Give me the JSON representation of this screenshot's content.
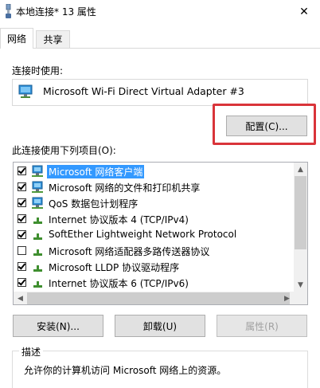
{
  "window": {
    "title": "本地连接* 13 属性",
    "close_glyph": "✕"
  },
  "tabs": [
    {
      "label": "网络",
      "active": true
    },
    {
      "label": "共享",
      "active": false
    }
  ],
  "connect_using": {
    "label": "连接时使用:",
    "adapter_name": "Microsoft Wi-Fi Direct Virtual Adapter #3",
    "adapter_icon": "network-adapter-icon",
    "configure_label": "配置(C)..."
  },
  "items_section": {
    "label": "此连接使用下列项目(O):",
    "items": [
      {
        "label": "Microsoft 网络客户端",
        "checked": true,
        "selected": true,
        "icon": "client-icon"
      },
      {
        "label": "Microsoft 网络的文件和打印机共享",
        "checked": true,
        "selected": false,
        "icon": "client-icon"
      },
      {
        "label": "QoS 数据包计划程序",
        "checked": true,
        "selected": false,
        "icon": "client-icon"
      },
      {
        "label": "Internet 协议版本 4 (TCP/IPv4)",
        "checked": true,
        "selected": false,
        "icon": "protocol-icon"
      },
      {
        "label": "SoftEther Lightweight Network Protocol",
        "checked": true,
        "selected": false,
        "icon": "protocol-icon"
      },
      {
        "label": "Microsoft 网络适配器多路传送器协议",
        "checked": false,
        "selected": false,
        "icon": "protocol-icon"
      },
      {
        "label": "Microsoft LLDP 协议驱动程序",
        "checked": true,
        "selected": false,
        "icon": "protocol-icon"
      },
      {
        "label": "Internet 协议版本 6 (TCP/IPv6)",
        "checked": true,
        "selected": false,
        "icon": "protocol-icon"
      }
    ]
  },
  "buttons": {
    "install": "安装(N)...",
    "uninstall": "卸载(U)",
    "properties": "属性(R)"
  },
  "description": {
    "label": "描述",
    "text": "允许你的计算机访问 Microsoft 网络上的资源。"
  },
  "colors": {
    "selection": "#3399ff",
    "highlight": "#d9343a"
  }
}
